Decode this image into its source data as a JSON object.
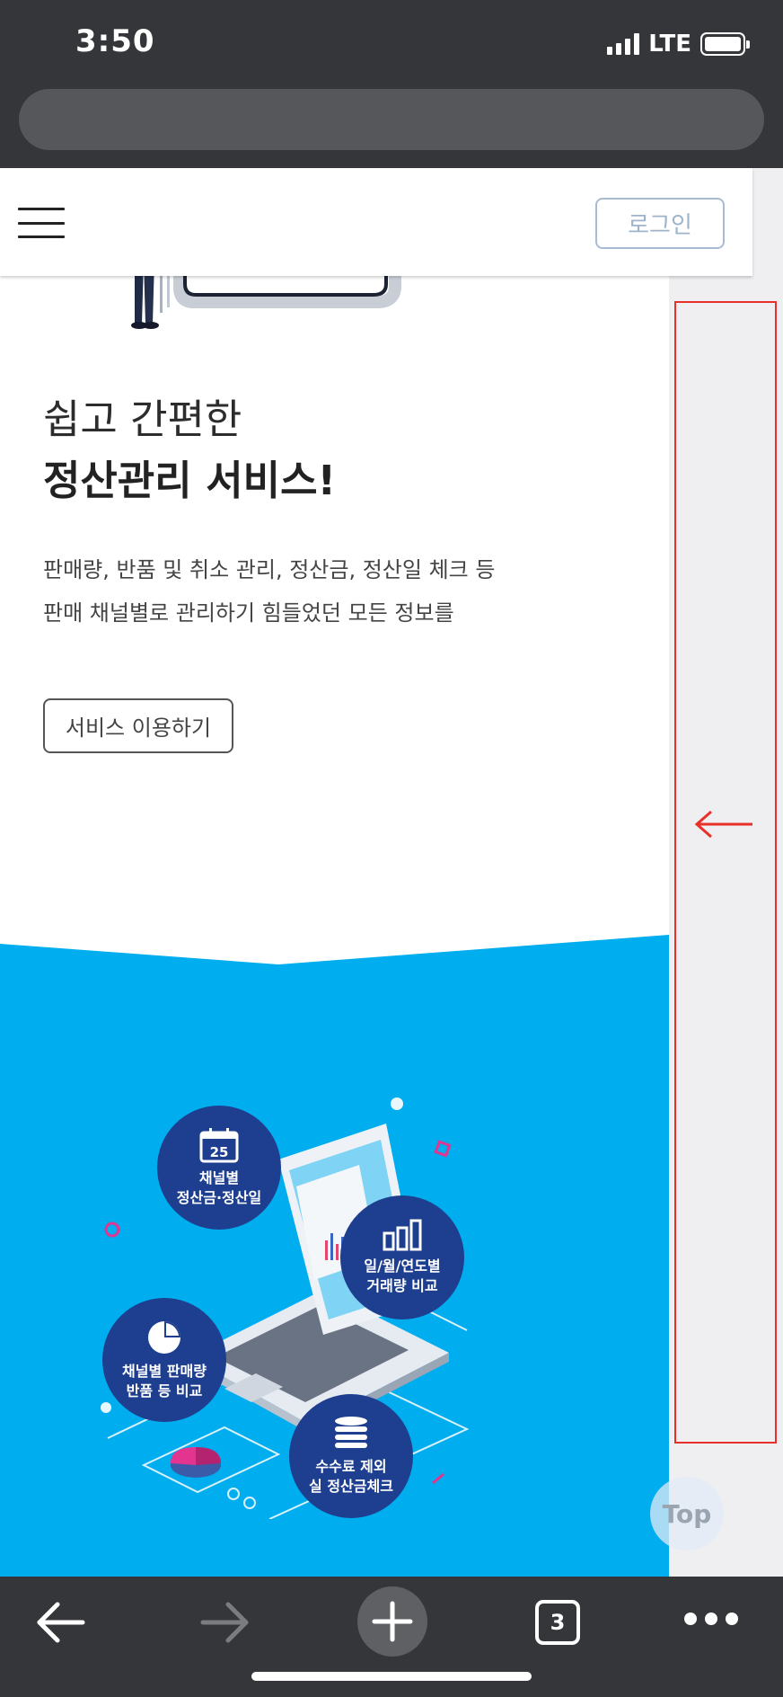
{
  "status_bar": {
    "time": "3:50",
    "network": "LTE"
  },
  "header": {
    "login_label": "로그인"
  },
  "hero": {
    "headline_light": "쉽고 간편한",
    "headline_bold": "정산관리 서비스!",
    "desc_line1": "판매량, 반품 및 취소 관리, 정산금, 정산일 체크 등",
    "desc_line2": "판매 채널별로 관리하기 힘들었던 모든 정보를",
    "cta_label": "서비스 이용하기"
  },
  "features": {
    "calendar_day": "25",
    "items": [
      {
        "line1": "채널별",
        "line2": "정산금·정산일",
        "icon": "calendar-icon"
      },
      {
        "line1": "일/월/연도별",
        "line2": "거래량 비교",
        "icon": "bar-chart-icon"
      },
      {
        "line1": "채널별 판매량",
        "line2": "반품 등 비교",
        "icon": "pie-chart-icon"
      },
      {
        "line1": "수수료 제외",
        "line2": "실 정산금체크",
        "icon": "coin-stack-icon"
      }
    ]
  },
  "top_button": {
    "label": "Top"
  },
  "toolbar": {
    "tab_count": "3"
  },
  "colors": {
    "section_blue": "#00adee",
    "bubble_navy": "#1e3f8f",
    "highlight_red": "#e8302b",
    "chrome_dark": "#35363a"
  }
}
